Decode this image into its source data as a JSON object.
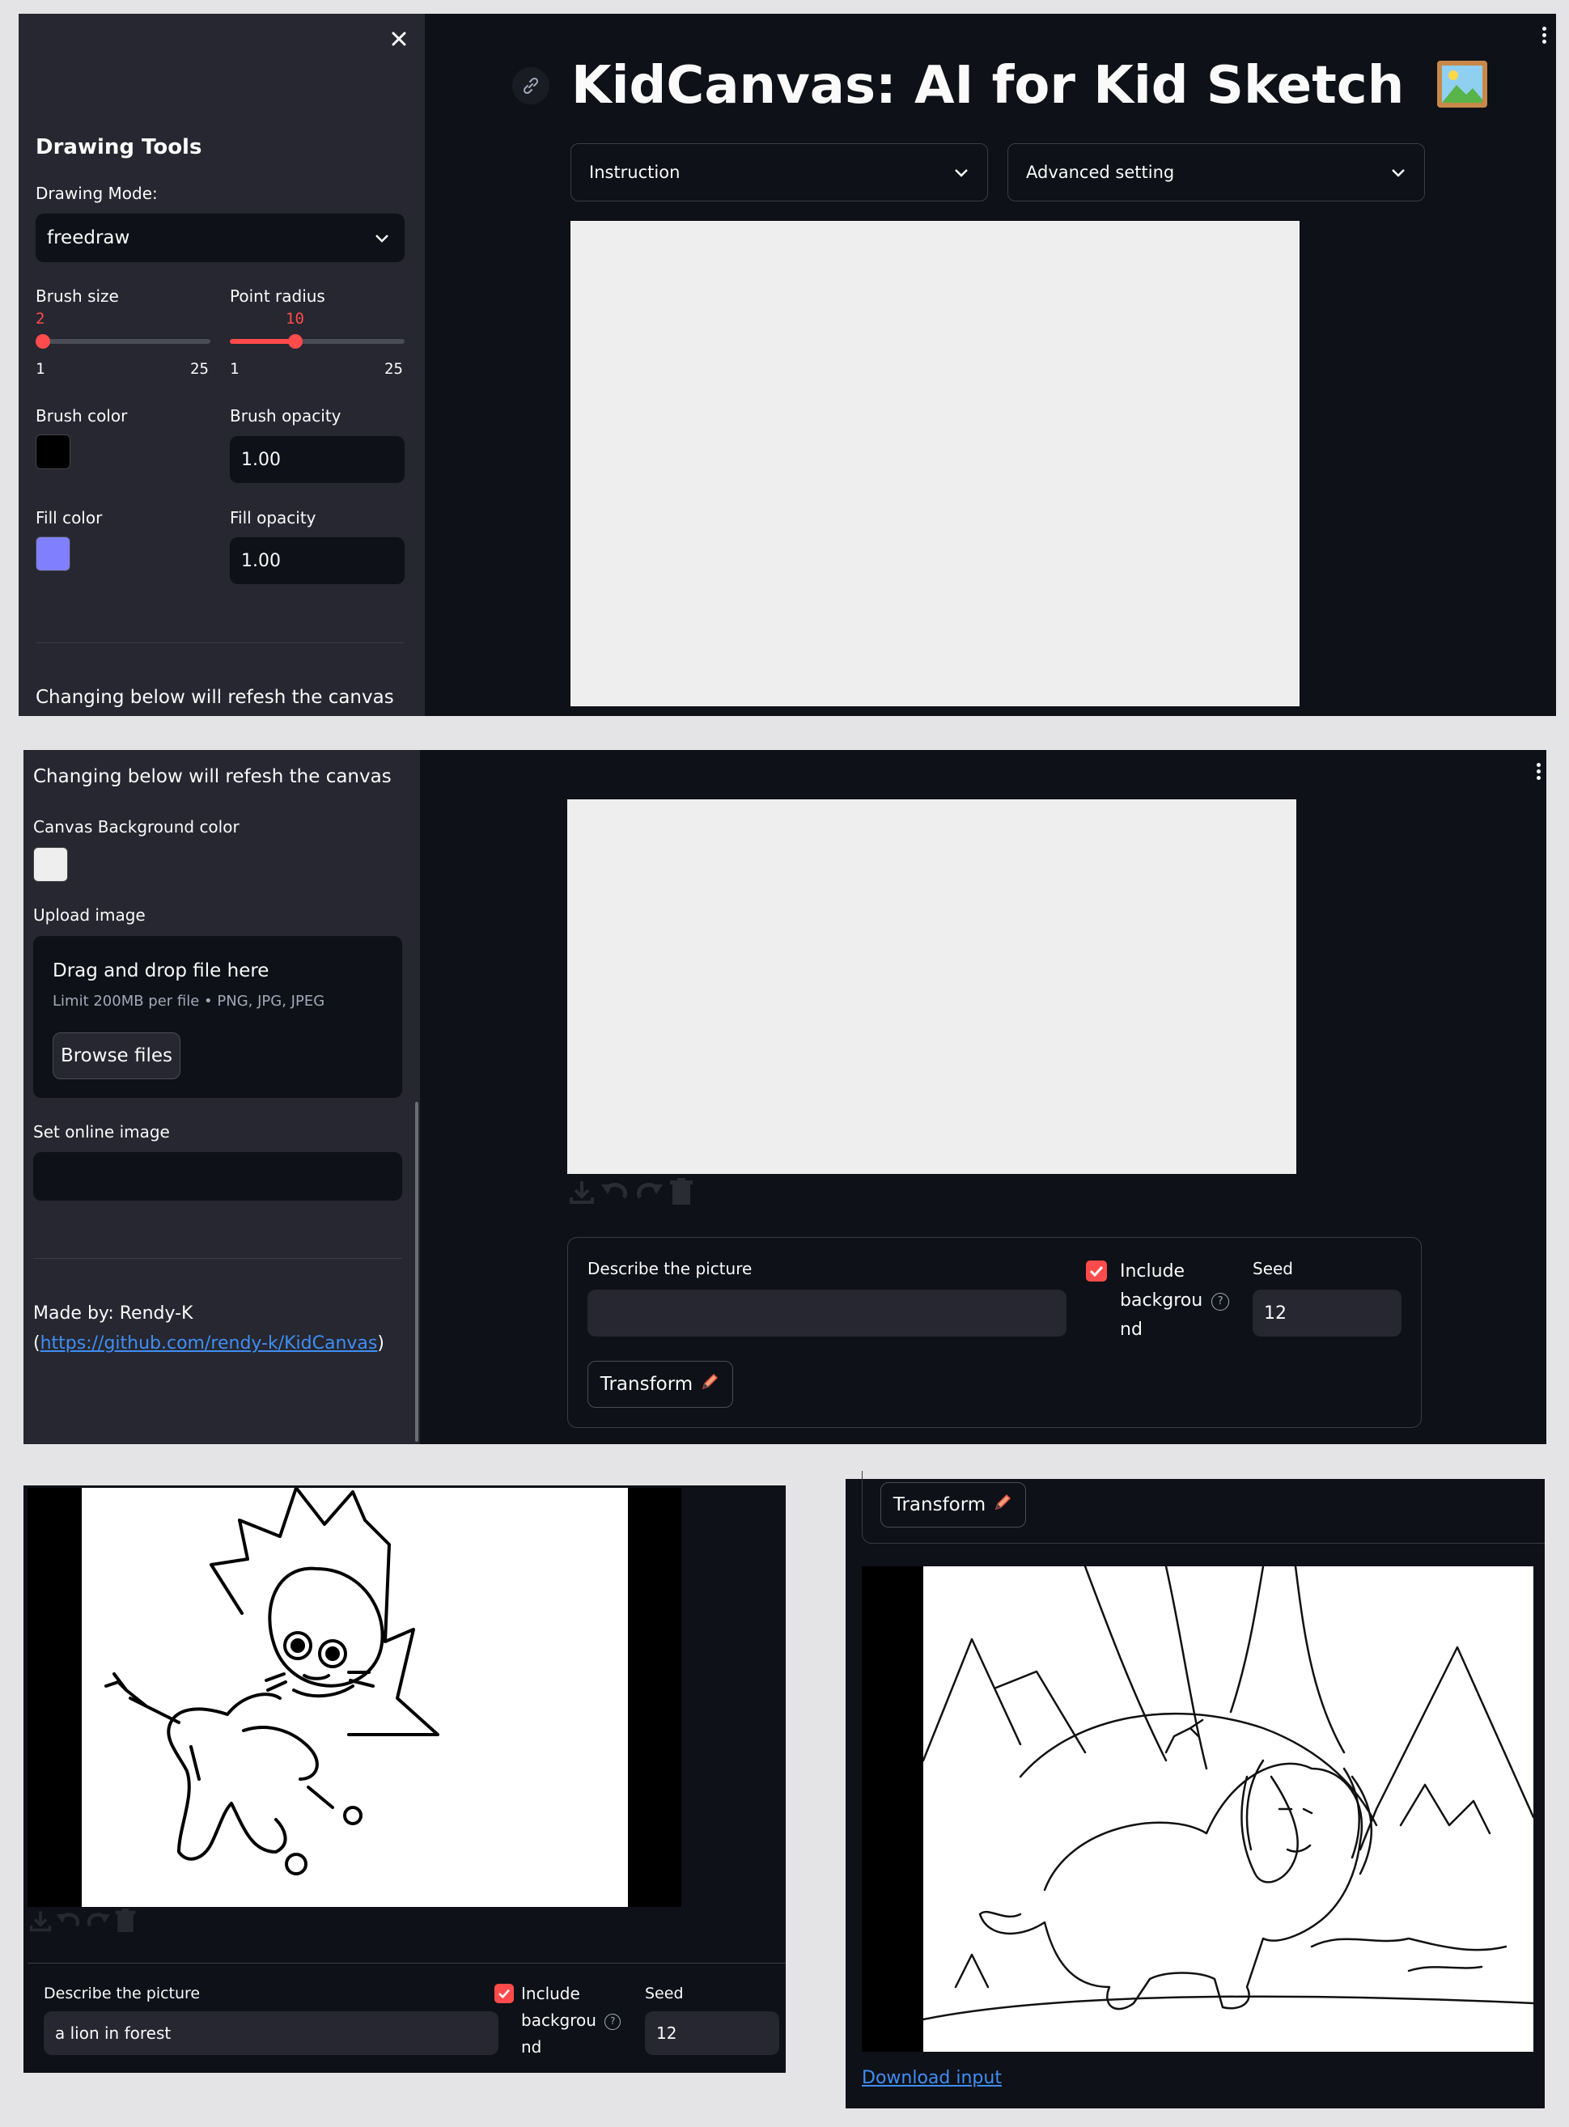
{
  "app": {
    "title": "KidCanvas: AI for Kid Sketch",
    "title_emoji": "🖼️"
  },
  "expanders": {
    "instruction": "Instruction",
    "advanced": "Advanced setting"
  },
  "sidebar": {
    "heading": "Drawing Tools",
    "drawing_mode_label": "Drawing Mode:",
    "drawing_mode_value": "freedraw",
    "brush_size": {
      "label": "Brush size",
      "value": "2",
      "min": "1",
      "max": "25",
      "fraction": 0.04
    },
    "point_radius": {
      "label": "Point radius",
      "value": "10",
      "min": "1",
      "max": "25",
      "fraction": 0.375
    },
    "brush_color_label": "Brush color",
    "brush_opacity_label": "Brush opacity",
    "brush_opacity_value": "1.00",
    "fill_color_label": "Fill color",
    "fill_opacity_label": "Fill opacity",
    "fill_opacity_value": "1.00",
    "refresh_note": "Changing below will refesh the canvas",
    "canvas_bg_label": "Canvas Background color",
    "upload_label": "Upload image",
    "dropzone_title": "Drag and drop file here",
    "dropzone_limit": "Limit 200MB per file • PNG, JPG, JPEG",
    "browse_button": "Browse files",
    "online_image_label": "Set online image",
    "online_image_value": "",
    "made_by_prefix": "Made by: Rendy-K (",
    "made_by_link": "https://github.com/rendy-k/KidCanvas",
    "made_by_suffix": ")"
  },
  "form": {
    "describe_label": "Describe the picture",
    "describe_value_empty": "",
    "describe_value_filled": "a lion in forest",
    "include_bg_label": "Include backgrou nd",
    "include_bg_label_line1": "Include",
    "include_bg_label_line2": "backgrou",
    "include_bg_label_line3": "nd",
    "include_bg_checked": true,
    "seed_label": "Seed",
    "seed_value": "12",
    "transform_button": "Transform",
    "transform_icon": "✏️"
  },
  "output": {
    "download_link": "Download input"
  },
  "colors": {
    "bg": "#0e1117",
    "sidebar": "#262730",
    "accent": "#ff4b4b",
    "brush_color": "#000000",
    "fill_color": "#8080ff",
    "canvas_bg": "#eeeeee",
    "link": "#3f8ef5"
  },
  "icons": {
    "close": "close-icon",
    "link": "link-icon",
    "chevron": "chevron-down-icon",
    "download": "download-icon",
    "undo": "undo-icon",
    "redo": "redo-icon",
    "trash": "trash-icon",
    "help": "help-icon",
    "menu": "kebab-menu-icon"
  }
}
